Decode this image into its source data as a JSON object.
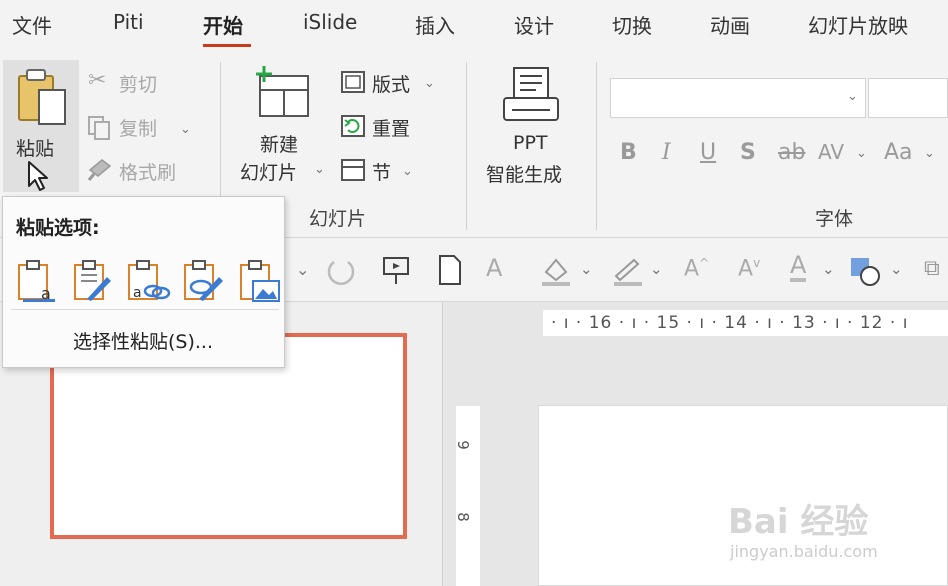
{
  "menu": {
    "tabs": [
      "文件",
      "Piti",
      "开始",
      "iSlide",
      "插入",
      "设计",
      "切换",
      "动画",
      "幻灯片放映"
    ],
    "active_index": 2
  },
  "clipboard": {
    "paste_label": "粘贴",
    "cut_label": "剪切",
    "copy_label": "复制",
    "format_painter_label": "格式刷"
  },
  "slides": {
    "new_slide_line1": "新建",
    "new_slide_line2": "幻灯片",
    "layout_label": "版式",
    "reset_label": "重置",
    "section_label": "节",
    "group_label": "幻灯片"
  },
  "ppt_gen": {
    "line1": "PPT",
    "line2": "智能生成"
  },
  "font": {
    "group_label": "字体",
    "buttons": [
      "B",
      "I",
      "U",
      "S",
      "ab",
      "AV",
      "Aa"
    ]
  },
  "ruler": {
    "horizontal": "· ı · 16 · ı · 15 · ı · 14 · ı · 13 · ı · 12 · ı",
    "vertical": [
      "9",
      "8"
    ]
  },
  "paste_popup": {
    "title": "粘贴选项:",
    "options": [
      "use-destination-theme",
      "keep-source-formatting",
      "embed",
      "picture-keep-format",
      "picture"
    ],
    "special": "选择性粘贴(S)..."
  },
  "watermark": {
    "text": "Bai 经验",
    "url": "jingyan.baidu.com"
  },
  "colors": {
    "accent": "#c43e1c",
    "thumb_border": "#e26b52",
    "icon_blue": "#3b7bd3",
    "icon_orange": "#d9822b"
  }
}
